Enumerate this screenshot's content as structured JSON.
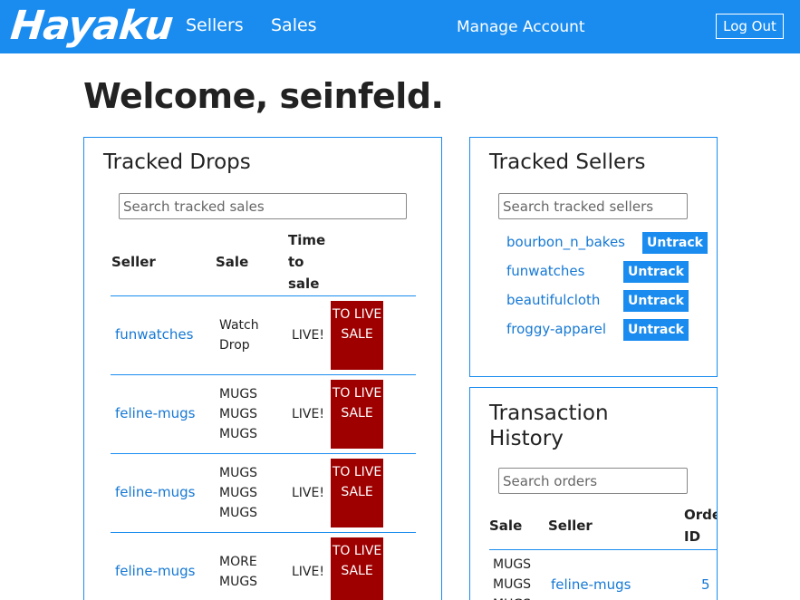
{
  "nav": {
    "brand": "Hayaku",
    "sellers": "Sellers",
    "sales": "Sales",
    "manage": "Manage Account",
    "logout": "Log Out"
  },
  "welcome": "Welcome, seinfeld.",
  "drops": {
    "title": "Tracked Drops",
    "search_placeholder": "Search tracked sales",
    "headers": {
      "seller": "Seller",
      "sale": "Sale",
      "time": "Time to sale"
    },
    "rows": [
      {
        "seller": "funwatches",
        "sale": "Watch Drop",
        "time": "LIVE!",
        "action": "TO LIVE SALE"
      },
      {
        "seller": "feline-mugs",
        "sale": "MUGS MUGS MUGS",
        "time": "LIVE!",
        "action": "TO LIVE SALE"
      },
      {
        "seller": "feline-mugs",
        "sale": "MUGS MUGS MUGS",
        "time": "LIVE!",
        "action": "TO LIVE SALE"
      },
      {
        "seller": "feline-mugs",
        "sale": "MORE MUGS",
        "time": "LIVE!",
        "action": "TO LIVE SALE"
      }
    ]
  },
  "sellers": {
    "title": "Tracked Sellers",
    "search_placeholder": "Search tracked sellers",
    "untrack_label": "Untrack",
    "items": [
      {
        "name": "bourbon_n_bakes"
      },
      {
        "name": "funwatches"
      },
      {
        "name": "beautifulcloth"
      },
      {
        "name": "froggy-apparel"
      }
    ]
  },
  "history": {
    "title": "Transaction History",
    "search_placeholder": "Search orders",
    "headers": {
      "sale": "Sale",
      "seller": "Seller",
      "order": "Order ID"
    },
    "rows": [
      {
        "sale": "MUGS MUGS MUGS",
        "seller": "feline-mugs",
        "order": "5"
      }
    ]
  }
}
